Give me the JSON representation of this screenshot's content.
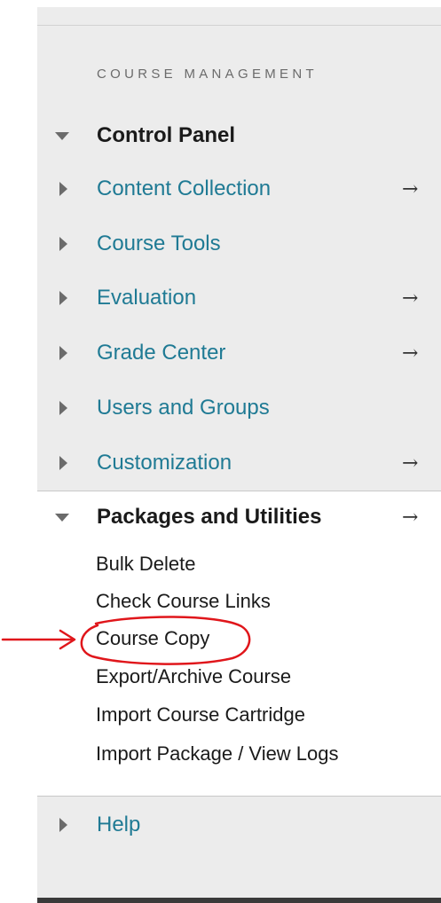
{
  "course_management": {
    "heading": "COURSE MANAGEMENT",
    "control_panel": {
      "label": "Control Panel",
      "items": [
        {
          "label": "Content Collection",
          "has_arrow": true
        },
        {
          "label": "Course Tools",
          "has_arrow": false
        },
        {
          "label": "Evaluation",
          "has_arrow": true
        },
        {
          "label": "Grade Center",
          "has_arrow": true
        },
        {
          "label": "Users and Groups",
          "has_arrow": false
        },
        {
          "label": "Customization",
          "has_arrow": true
        }
      ]
    },
    "packages_and_utilities": {
      "label": "Packages and Utilities",
      "sub_items": [
        "Bulk Delete",
        "Check Course Links",
        "Course Copy",
        "Export/Archive Course",
        "Import Course Cartridge",
        "Import Package / View Logs"
      ]
    },
    "help": {
      "label": "Help"
    }
  },
  "arrow_glyph": "→",
  "colors": {
    "link": "#1f7a94",
    "annotation": "#e0161b",
    "panel_background": "#ececec"
  },
  "icons": {
    "collapsed": "triangle-right-icon",
    "expanded": "triangle-down-icon",
    "navigate": "arrow-right-icon"
  }
}
